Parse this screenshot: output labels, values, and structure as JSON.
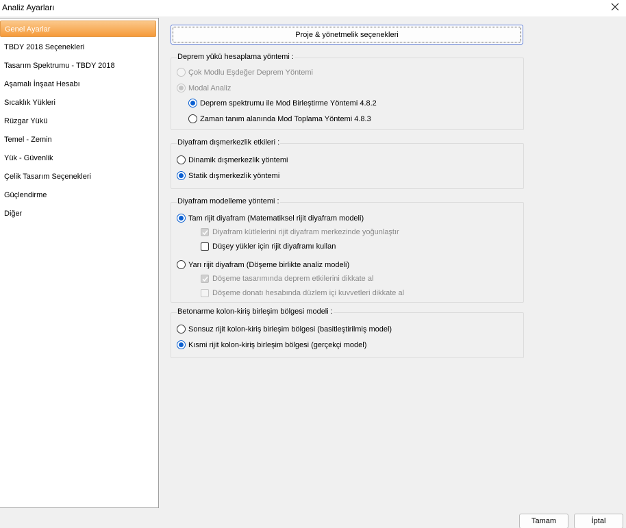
{
  "window": {
    "title": "Analiz Ayarları"
  },
  "sidebar": {
    "items": [
      {
        "label": "Genel Ayarlar"
      },
      {
        "label": "TBDY 2018 Seçenekleri"
      },
      {
        "label": "Tasarım Spektrumu - TBDY 2018"
      },
      {
        "label": "Aşamalı İnşaat Hesabı"
      },
      {
        "label": "Sıcaklık Yükleri"
      },
      {
        "label": "Rüzgar Yükü"
      },
      {
        "label": "Temel - Zemin"
      },
      {
        "label": "Yük - Güvenlik"
      },
      {
        "label": "Çelik Tasarım Seçenekleri"
      },
      {
        "label": "Güçlendirme"
      },
      {
        "label": "Diğer"
      }
    ]
  },
  "main": {
    "project_button": "Proje & yönetmelik seçenekleri",
    "earthquake": {
      "title": "Deprem yükü hesaplama yöntemi :",
      "options": [
        "Çok Modlu Eşdeğer Deprem Yöntemi",
        "Modal Analiz",
        "Deprem spektrumu ile Mod Birleştirme Yöntemi 4.8.2",
        "Zaman tanım alanında Mod Toplama Yöntemi 4.8.3"
      ]
    },
    "eccentricity": {
      "title": "Diyafram dışmerkezlik etkileri :",
      "options": [
        "Dinamik dışmerkezlik yöntemi",
        "Statik dışmerkezlik yöntemi"
      ]
    },
    "diaphragm": {
      "title": "Diyafram modelleme yöntemi  :",
      "rigid": "Tam rijit diyafram (Matematiksel rijit diyafram modeli)",
      "rigid_check1": "Diyafram kütlelerini rijit diyafram merkezinde yoğunlaştır",
      "rigid_check2": "Düşey yükler için rijit diyaframı kullan",
      "semi": "Yarı rijit diyafram (Döşeme birlikte analiz modeli)",
      "semi_check1": "Döşeme tasarımında deprem etkilerini dikkate al",
      "semi_check2": "Döşeme donatı hesabında düzlem içi kuvvetleri dikkate al"
    },
    "joint": {
      "title": "Betonarme kolon-kiriş birleşim bölgesi modeli :",
      "options": [
        "Sonsuz rijit kolon-kiriş birleşim bölgesi (basitleştirilmiş model)",
        "Kısmi rijit kolon-kiriş birleşim bölgesi (gerçekçi model)"
      ]
    }
  },
  "footer": {
    "ok": "Tamam",
    "cancel": "İptal"
  }
}
